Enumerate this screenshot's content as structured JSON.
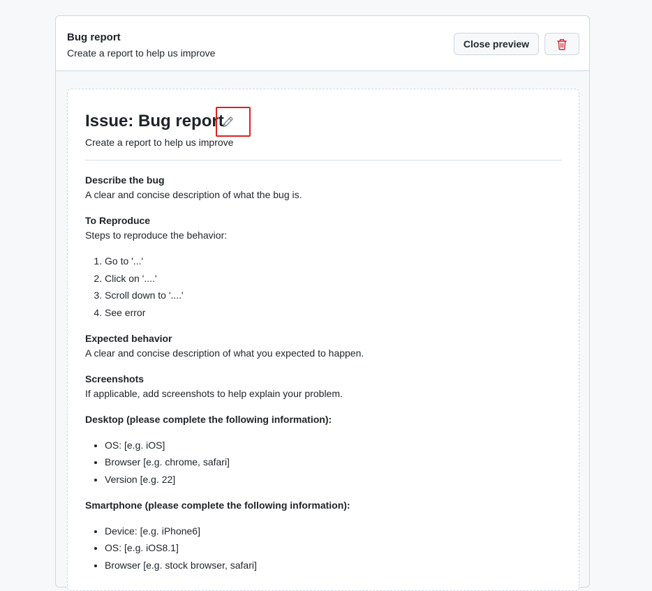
{
  "header": {
    "title": "Bug report",
    "subtitle": "Create a report to help us improve",
    "close_label": "Close preview",
    "delete_icon": "trash-icon",
    "delete_icon_color": "#cf222e"
  },
  "preview": {
    "title": "Issue: Bug report",
    "edit_icon": "pencil-icon",
    "subtitle": "Create a report to help us improve",
    "sections": {
      "describe": {
        "heading": "Describe the bug",
        "text": "A clear and concise description of what the bug is."
      },
      "reproduce": {
        "heading": "To Reproduce",
        "text": "Steps to reproduce the behavior:",
        "steps": [
          "Go to '...'",
          "Click on '....'",
          "Scroll down to '....'",
          "See error"
        ]
      },
      "expected": {
        "heading": "Expected behavior",
        "text": "A clear and concise description of what you expected to happen."
      },
      "screenshots": {
        "heading": "Screenshots",
        "text": "If applicable, add screenshots to help explain your problem."
      },
      "desktop": {
        "heading": "Desktop (please complete the following information):",
        "items": [
          "OS: [e.g. iOS]",
          "Browser [e.g. chrome, safari]",
          "Version [e.g. 22]"
        ]
      },
      "smartphone": {
        "heading": "Smartphone (please complete the following information):",
        "items": [
          "Device: [e.g. iPhone6]",
          "OS: [e.g. iOS8.1]",
          "Browser [e.g. stock browser, safari]"
        ]
      }
    }
  },
  "colors": {
    "highlight_box": "#e02020",
    "border": "#d0d7de",
    "background": "#f6f8fa"
  }
}
